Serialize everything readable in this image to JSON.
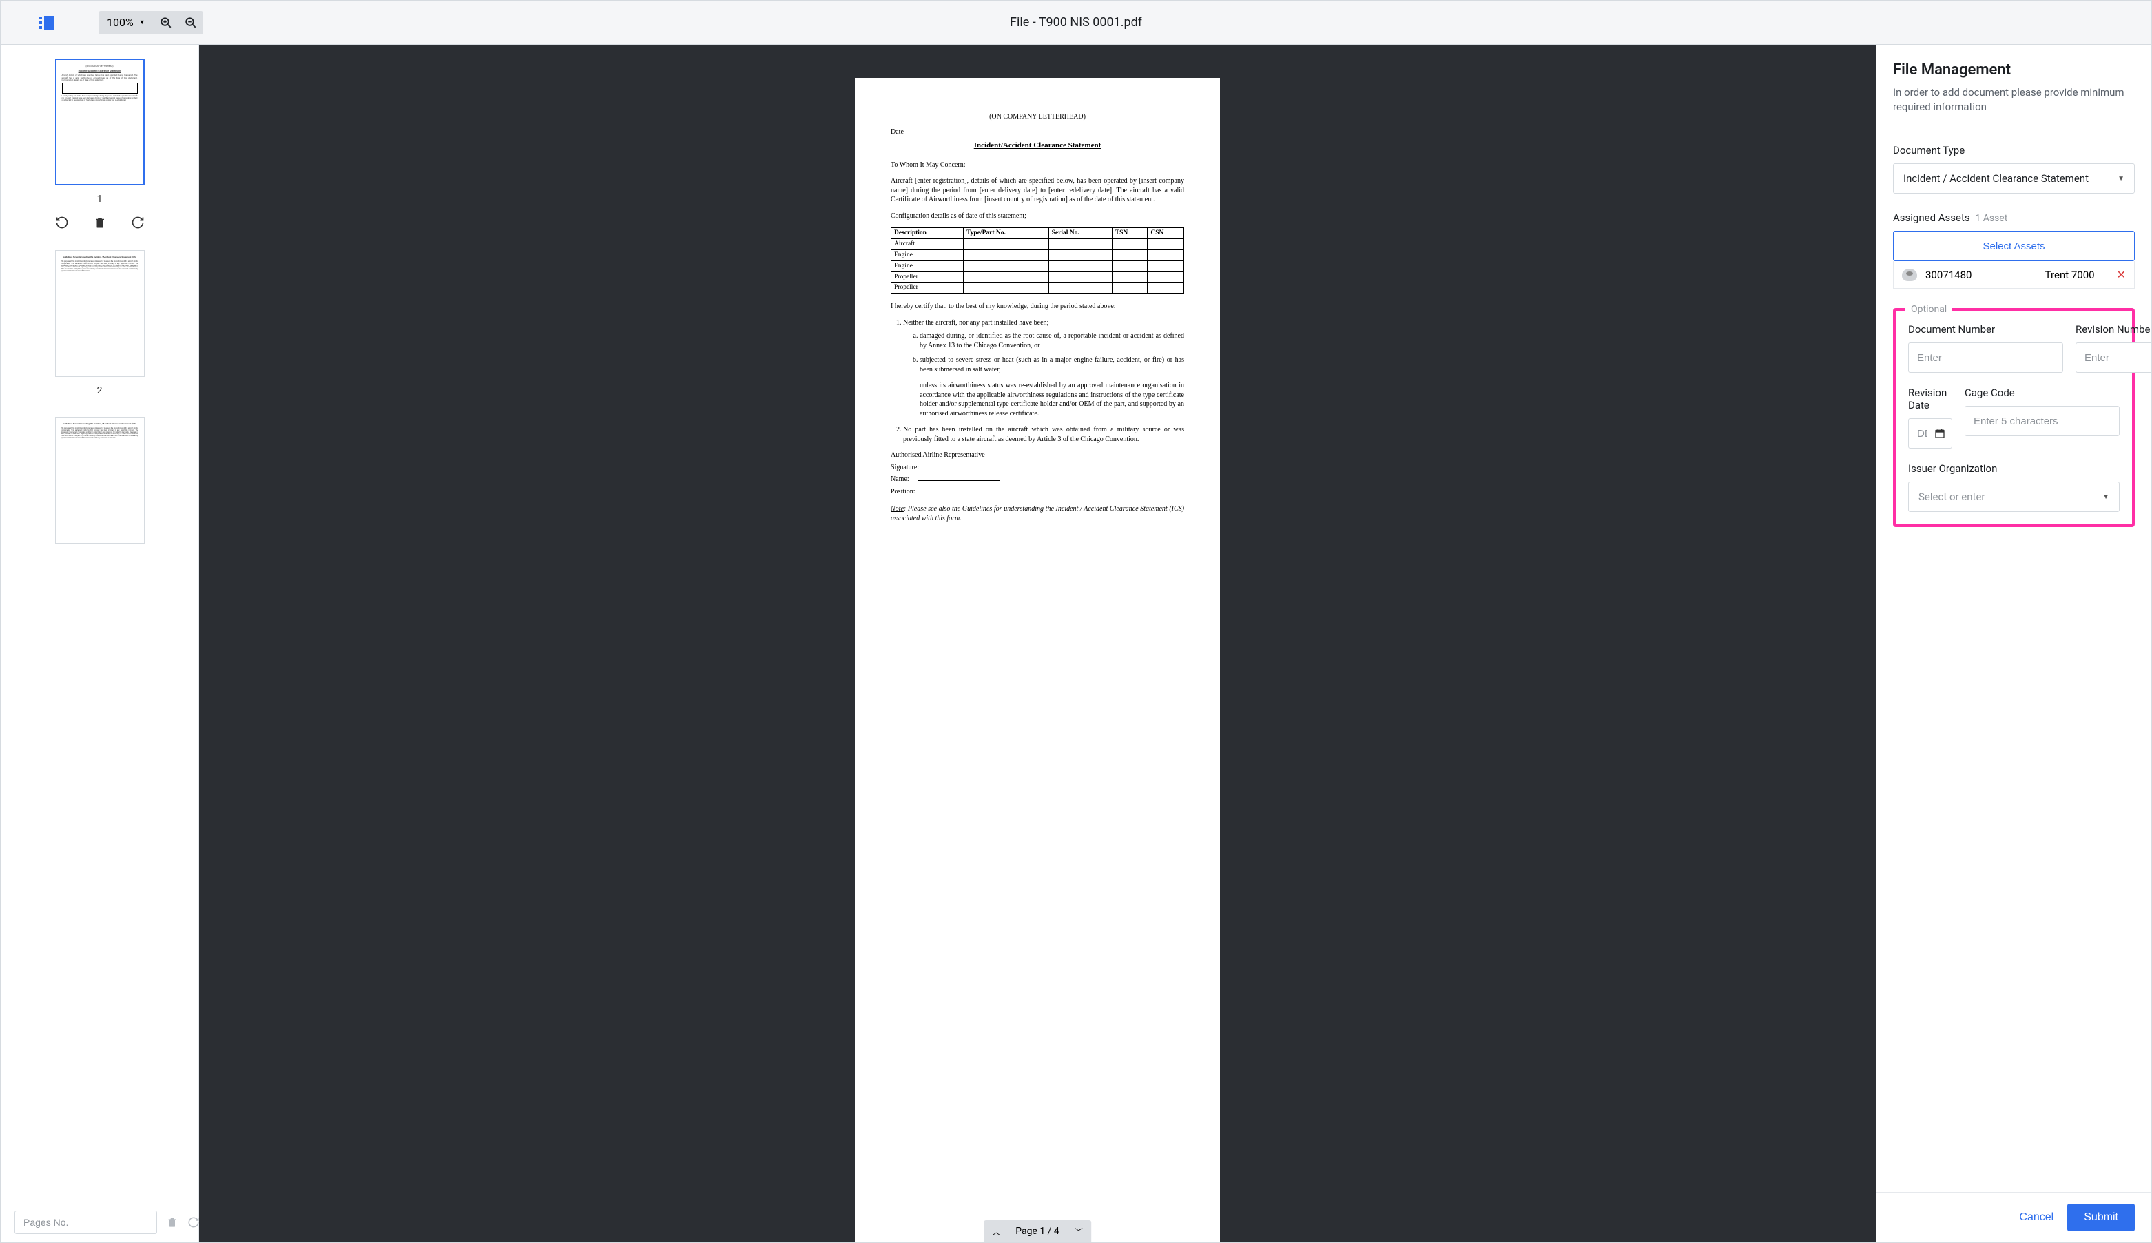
{
  "topbar": {
    "zoom": "100%",
    "title": "File - T900 NIS 0001.pdf"
  },
  "thumbs": {
    "pages": [
      "1",
      "2"
    ],
    "pages_no_placeholder": "Pages No."
  },
  "pager": {
    "label": "Page 1 / 4"
  },
  "document": {
    "letterhead": "(ON COMPANY LETTERHEAD)",
    "date_label": "Date",
    "title": "Incident/Accident Clearance Statement",
    "salutation": "To Whom It May Concern:",
    "para1": "Aircraft [enter registration], details of which are specified below, has been operated by [insert company name] during the period from [enter delivery date] to [enter redelivery date]. The aircraft has a valid Certificate of Airworthiness from [insert country of registration] as of the date of this statement.",
    "config_line": "Configuration details as of date of this statement;",
    "table_headers": [
      "Description",
      "Type/Part No.",
      "Serial No.",
      "TSN",
      "CSN"
    ],
    "table_rows": [
      "Aircraft",
      "Engine",
      "Engine",
      "Propeller",
      "Propeller"
    ],
    "certify": "I hereby certify that, to the best of my knowledge, during the period stated above:",
    "item1_lead": "Neither the aircraft, nor any part installed have been;",
    "item1a": "damaged during, or identified as the root cause of, a reportable incident or accident as defined by Annex 13 to the Chicago Convention, or",
    "item1b": "subjected to severe stress or heat (such as in a major engine failure, accident, or fire) or has been submersed in salt water,",
    "item1_unless": "unless its airworthiness status was re-established by an approved maintenance organisation in accordance with the applicable airworthiness regulations and instructions of the type certificate holder and/or supplemental type certificate holder and/or OEM of the part, and supported by an authorised airworthiness release certificate.",
    "item2": "No part has been installed on the aircraft which was obtained from a military source or was previously fitted to a state aircraft as deemed by Article 3 of the Chicago Convention.",
    "rep_heading": "Authorised Airline Representative",
    "sig_label": "Signature:",
    "name_label": "Name:",
    "pos_label": "Position:",
    "note_label": "Note",
    "note_text": ": Please see also the Guidelines for understanding the Incident / Accident Clearance Statement (ICS) associated with this form."
  },
  "side": {
    "title": "File Management",
    "subtitle": "In order to add document please provide minimum required information",
    "doc_type_label": "Document Type",
    "doc_type_value": "Incident / Accident Clearance Statement",
    "assets_label": "Assigned Assets",
    "assets_count": "1 Asset",
    "select_assets": "Select Assets",
    "asset_id": "30071480",
    "asset_name": "Trent 7000",
    "optional_label": "Optional",
    "doc_num_label": "Document Number",
    "doc_num_placeholder": "Enter",
    "rev_num_label": "Revision Number",
    "rev_num_placeholder": "Enter",
    "rev_date_label": "Revision Date",
    "rev_date_placeholder": "DD/MM/YYYY",
    "cage_label": "Cage Code",
    "cage_placeholder": "Enter 5 characters",
    "issuer_label": "Issuer Organization",
    "issuer_placeholder": "Select or enter",
    "cancel": "Cancel",
    "submit": "Submit"
  }
}
